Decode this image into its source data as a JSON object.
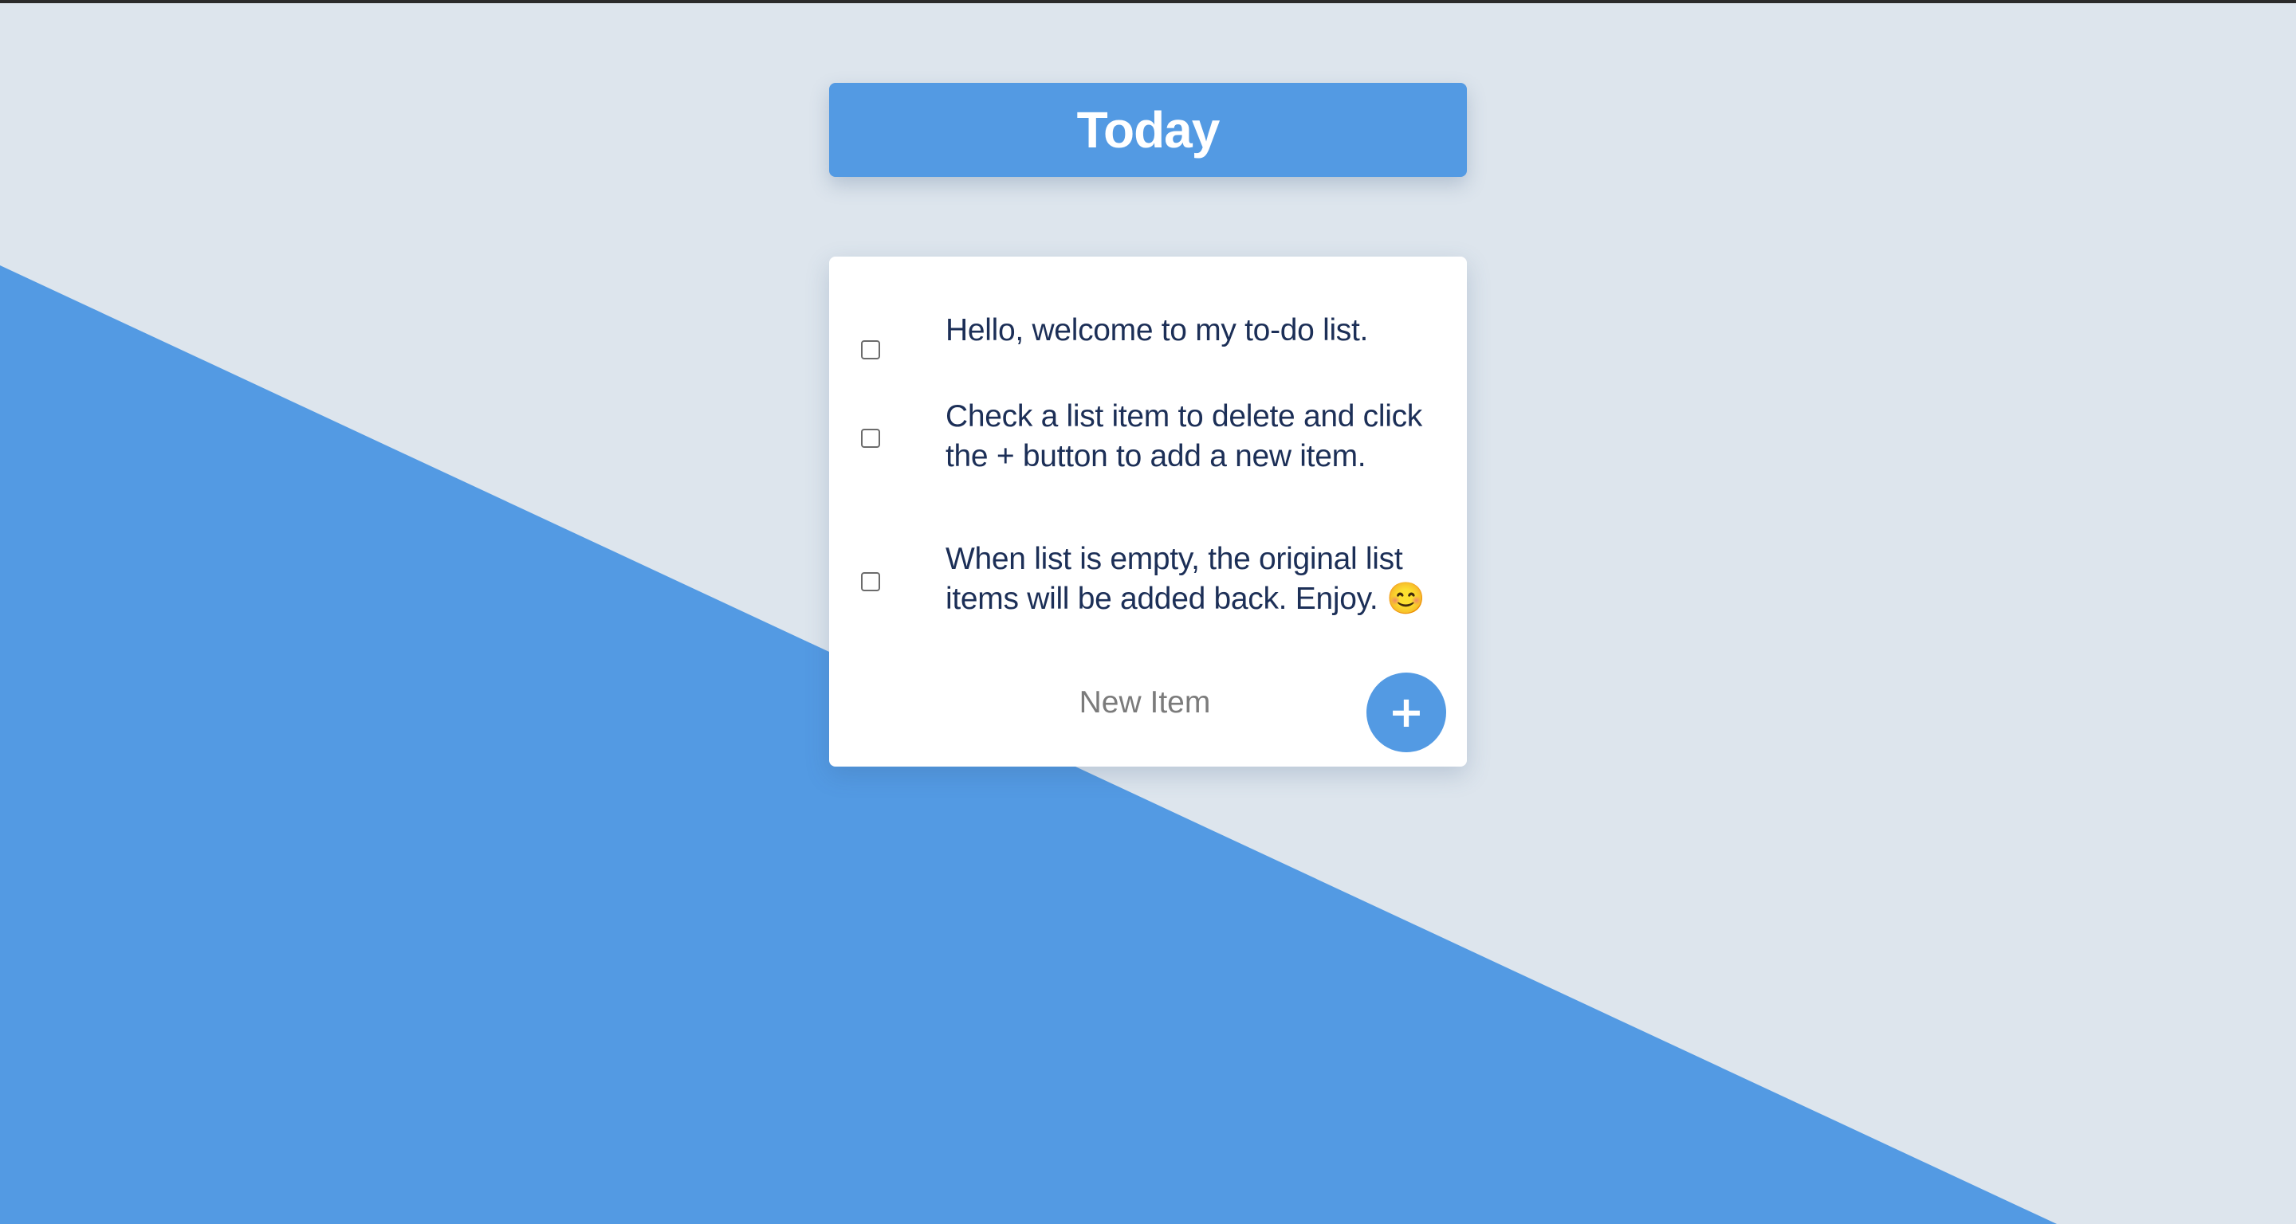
{
  "heading": {
    "title": "Today"
  },
  "todo": {
    "items": [
      {
        "text": "Hello, welcome to my to-do list.",
        "checked": false
      },
      {
        "text": "Check a list item to delete and click the + button to add a new item.",
        "checked": false
      },
      {
        "text": "When list is empty, the original list items will be added back. Enjoy. 😊",
        "checked": false
      }
    ],
    "new_item_placeholder": "New Item",
    "add_button_label": "+"
  },
  "colors": {
    "background": "#dde5ed",
    "accent": "#539ae3",
    "card": "#ffffff",
    "item_text": "#1c2f57"
  }
}
